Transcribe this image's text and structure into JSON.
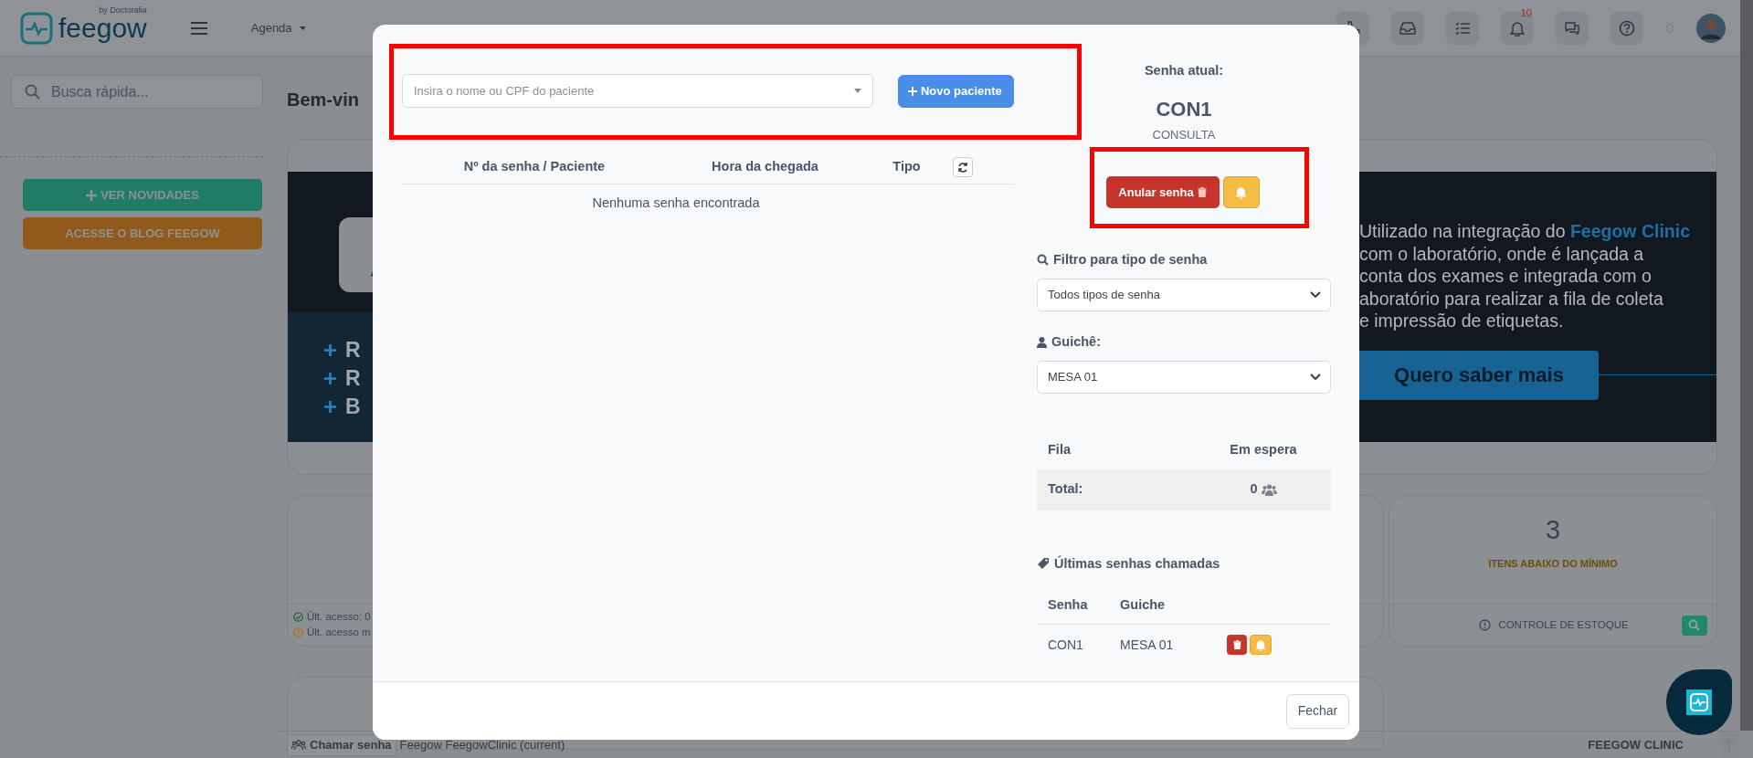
{
  "topbar": {
    "brand": "feegow",
    "tagline": "by Doctoralia",
    "menu": [
      {
        "label": "Agenda"
      }
    ],
    "notifications_badge": "10"
  },
  "sidebar": {
    "search": {
      "placeholder": "Busca rápida..."
    },
    "buttons": [
      {
        "label": "VER NOVIDADES",
        "kind": "news"
      },
      {
        "label": "ACESSE O BLOG FEEGOW",
        "kind": "blog"
      }
    ]
  },
  "main": {
    "heading": "Bem-vin",
    "banner": {
      "features": [
        "R",
        "R",
        "B"
      ],
      "description_lines": [
        "Utilizado na integração do **Feegow Clinic**",
        "com o laboratório, onde é lançada a",
        "conta dos exames e integrada com o",
        "aboratório para realizar a fila de coleta",
        "e impressão de etiquetas."
      ],
      "cta": "Quero saber mais"
    },
    "access_card": {
      "lines": [
        {
          "kind": "ok",
          "text": "Últ. acesso: 0"
        },
        {
          "kind": "warning",
          "text": "Últ. acesso m"
        }
      ]
    },
    "stock_card": {
      "count": "3",
      "caption": "ITENS ABAIXO DO MÍNIMO",
      "footer": "CONTROLE DE ESTOQUE"
    }
  },
  "bottom_bar": {
    "call_button": "Chamar senha",
    "environment": "Feegow FeegowClinic (current)",
    "brand": "FEEGOW CLINIC"
  },
  "modal": {
    "patient_search": {
      "placeholder": "Insira o nome ou CPF do paciente"
    },
    "new_patient_button": "Novo paciente",
    "queue_table": {
      "columns": [
        "Nº da senha / Paciente",
        "Hora da chegada",
        "Tipo"
      ],
      "empty_message": "Nenhuma senha encontrada"
    },
    "current": {
      "label": "Senha atual:",
      "code": "CON1",
      "type": "CONSULTA",
      "cancel_button": "Anular senha"
    },
    "filter": {
      "label": "Filtro para tipo de senha",
      "value": "Todos tipos de senha"
    },
    "counter": {
      "label": "Guichê:",
      "value": "MESA 01"
    },
    "queue_summary": {
      "columns": [
        "Fila",
        "Em espera"
      ],
      "rows": [
        {
          "label": "Total:",
          "waiting": "0"
        }
      ]
    },
    "recent": {
      "title": "Últimas senhas chamadas",
      "columns": [
        "Senha",
        "Guiche"
      ],
      "rows": [
        {
          "code": "CON1",
          "counter": "MESA 01"
        }
      ]
    },
    "close_button": "Fechar"
  }
}
